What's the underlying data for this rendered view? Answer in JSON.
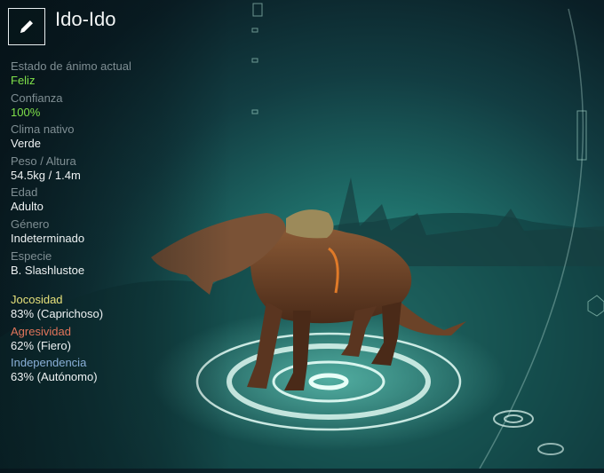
{
  "creature": {
    "name": "Ido-Ido"
  },
  "edit_icon": "pencil-icon",
  "stats": [
    {
      "label": "Estado de ánimo actual",
      "value": "Feliz",
      "highlight": true
    },
    {
      "label": "Confianza",
      "value": "100%",
      "highlight": true
    },
    {
      "label": "Clima nativo",
      "value": "Verde"
    },
    {
      "label": "Peso / Altura",
      "value": "54.5kg / 1.4m"
    },
    {
      "label": "Edad",
      "value": "Adulto"
    },
    {
      "label": "Género",
      "value": "Indeterminado"
    },
    {
      "label": "Especie",
      "value": "B. Slashlustoe"
    }
  ],
  "traits": [
    {
      "label": "Jocosidad",
      "value": "83% (Caprichoso)",
      "color": "#e6e07a"
    },
    {
      "label": "Agresividad",
      "value": "62% (Fiero)",
      "color": "#e0745a"
    },
    {
      "label": "Independencia",
      "value": "63% (Autónomo)",
      "color": "#8ab0d8"
    }
  ]
}
